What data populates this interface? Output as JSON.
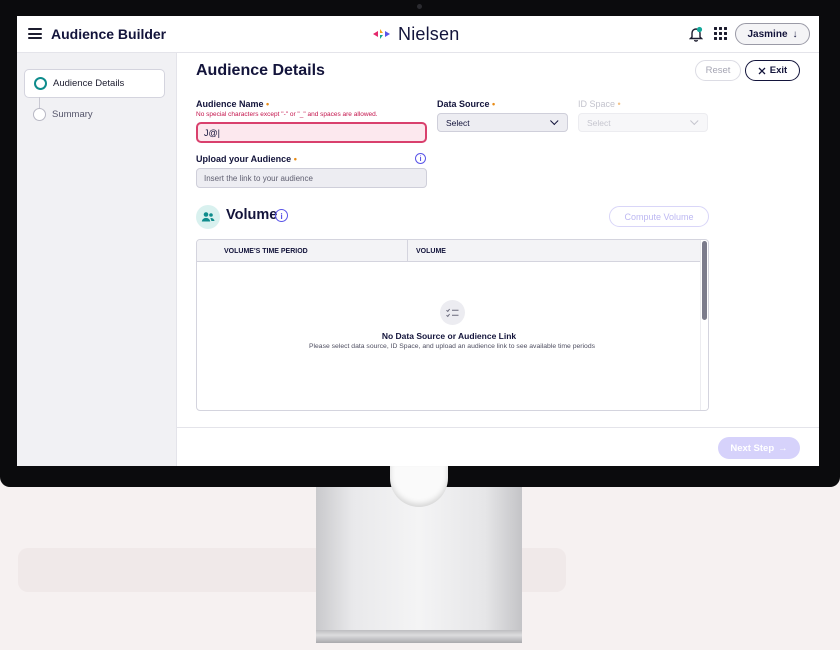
{
  "header": {
    "app_title": "Audience Builder",
    "brand_name": "Nielsen",
    "user_label": "Jasmine",
    "user_chevron": "↓"
  },
  "sidebar": {
    "steps": [
      {
        "label": "Audience Details",
        "state": "active"
      },
      {
        "label": "Summary",
        "state": "inactive"
      }
    ]
  },
  "main": {
    "page_title": "Audience Details",
    "reset_label": "Reset",
    "exit_label": "Exit",
    "audience_name": {
      "label": "Audience Name",
      "required_mark": "•",
      "error": "No special characters except \"-\" or \"_\" and spaces are allowed.",
      "value": "J@|"
    },
    "data_source": {
      "label": "Data Source",
      "required_mark": "•",
      "value": "Select"
    },
    "id_space": {
      "label": "ID Space",
      "required_mark": "•",
      "value": "Select"
    },
    "upload": {
      "label": "Upload your Audience",
      "required_mark": "•",
      "placeholder": "Insert the link to your audience"
    },
    "volume": {
      "title": "Volume",
      "compute_label": "Compute Volume",
      "columns": [
        "VOLUME'S TIME PERIOD",
        "VOLUME"
      ],
      "empty_title": "No Data Source or Audience Link",
      "empty_subtitle": "Please select data source, ID Space, and upload an audience link to see available time periods"
    },
    "next_label": "Next Step",
    "next_arrow": "→"
  },
  "colors": {
    "accent": "#5a55e8",
    "teal": "#0e8c8c",
    "error": "#c4144c",
    "required": "#e88b16"
  }
}
